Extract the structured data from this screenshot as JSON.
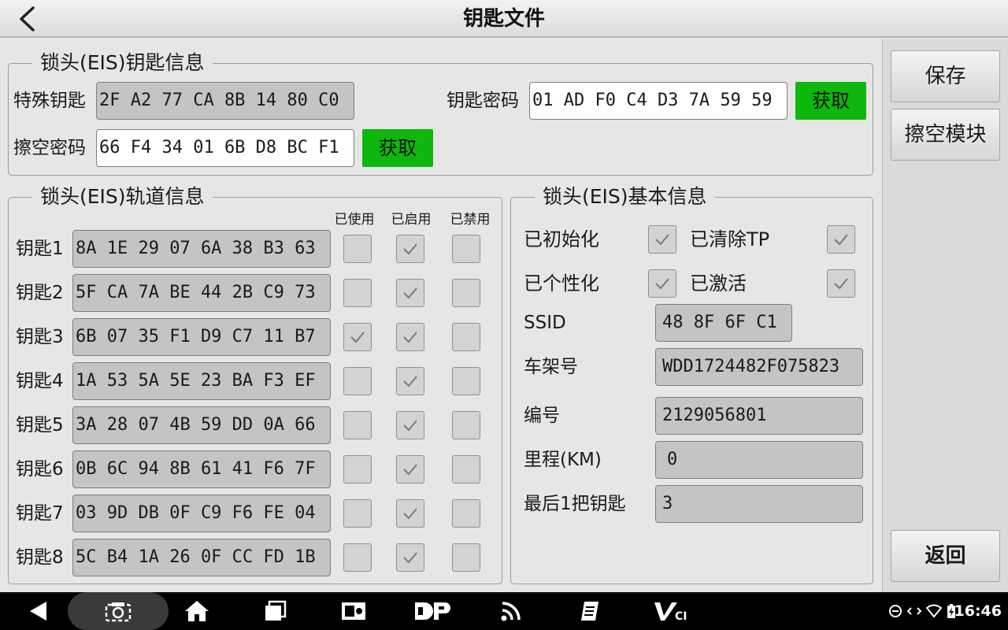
{
  "header": {
    "title": "钥匙文件"
  },
  "key_info": {
    "legend": "锁头(EIS)钥匙信息",
    "special_key_label": "特殊钥匙",
    "special_key_value": "2F A2 77 CA 8B 14 80 C0",
    "key_password_label": "钥匙密码",
    "key_password_value": "01 AD F0 C4 D3 7A 59 59",
    "erase_password_label": "擦空密码",
    "erase_password_value": "66 F4 34 01 6B D8 BC F1",
    "get_label": "获取"
  },
  "track_info": {
    "legend": "锁头(EIS)轨道信息",
    "columns": [
      "已使用",
      "已启用",
      "已禁用"
    ],
    "keys": [
      {
        "label": "钥匙1",
        "value": "8A 1E 29 07 6A 38 B3 63",
        "used": false,
        "enabled": true,
        "disabled": false
      },
      {
        "label": "钥匙2",
        "value": "5F CA 7A BE 44 2B C9 73",
        "used": false,
        "enabled": true,
        "disabled": false
      },
      {
        "label": "钥匙3",
        "value": "6B 07 35 F1 D9 C7 11 B7",
        "used": true,
        "enabled": true,
        "disabled": false
      },
      {
        "label": "钥匙4",
        "value": "1A 53 5A 5E 23 BA F3 EF",
        "used": false,
        "enabled": true,
        "disabled": false
      },
      {
        "label": "钥匙5",
        "value": "3A 28 07 4B 59 DD 0A 66",
        "used": false,
        "enabled": true,
        "disabled": false
      },
      {
        "label": "钥匙6",
        "value": "0B 6C 94 8B 61 41 F6 7F",
        "used": false,
        "enabled": true,
        "disabled": false
      },
      {
        "label": "钥匙7",
        "value": "03 9D DB 0F C9 F6 FE 04",
        "used": false,
        "enabled": true,
        "disabled": false
      },
      {
        "label": "钥匙8",
        "value": "5C B4 1A 26 0F CC FD 1B",
        "used": false,
        "enabled": true,
        "disabled": false
      }
    ]
  },
  "basic_info": {
    "legend": "锁头(EIS)基本信息",
    "initialized_label": "已初始化",
    "initialized": true,
    "tp_cleared_label": "已清除TP",
    "tp_cleared": true,
    "personalized_label": "已个性化",
    "personalized": true,
    "activated_label": "已激活",
    "activated": true,
    "ssid_label": "SSID",
    "ssid_value": "48 8F 6F C1",
    "vin_label": "车架号",
    "vin_value": "WDD1724482F075823",
    "number_label": "编号",
    "number_value": "2129056801",
    "mileage_label": "里程(KM)",
    "mileage_value": "0",
    "last_key_label": "最后1把钥匙",
    "last_key_value": "3"
  },
  "side": {
    "save": "保存",
    "erase_module": "擦空模块",
    "back": "返回"
  },
  "status_bar": {
    "time": "16:46"
  },
  "colors": {
    "accent_green": "#0DB70D",
    "field_gray": "#C4C4C4",
    "background": "#E6E6E6"
  }
}
